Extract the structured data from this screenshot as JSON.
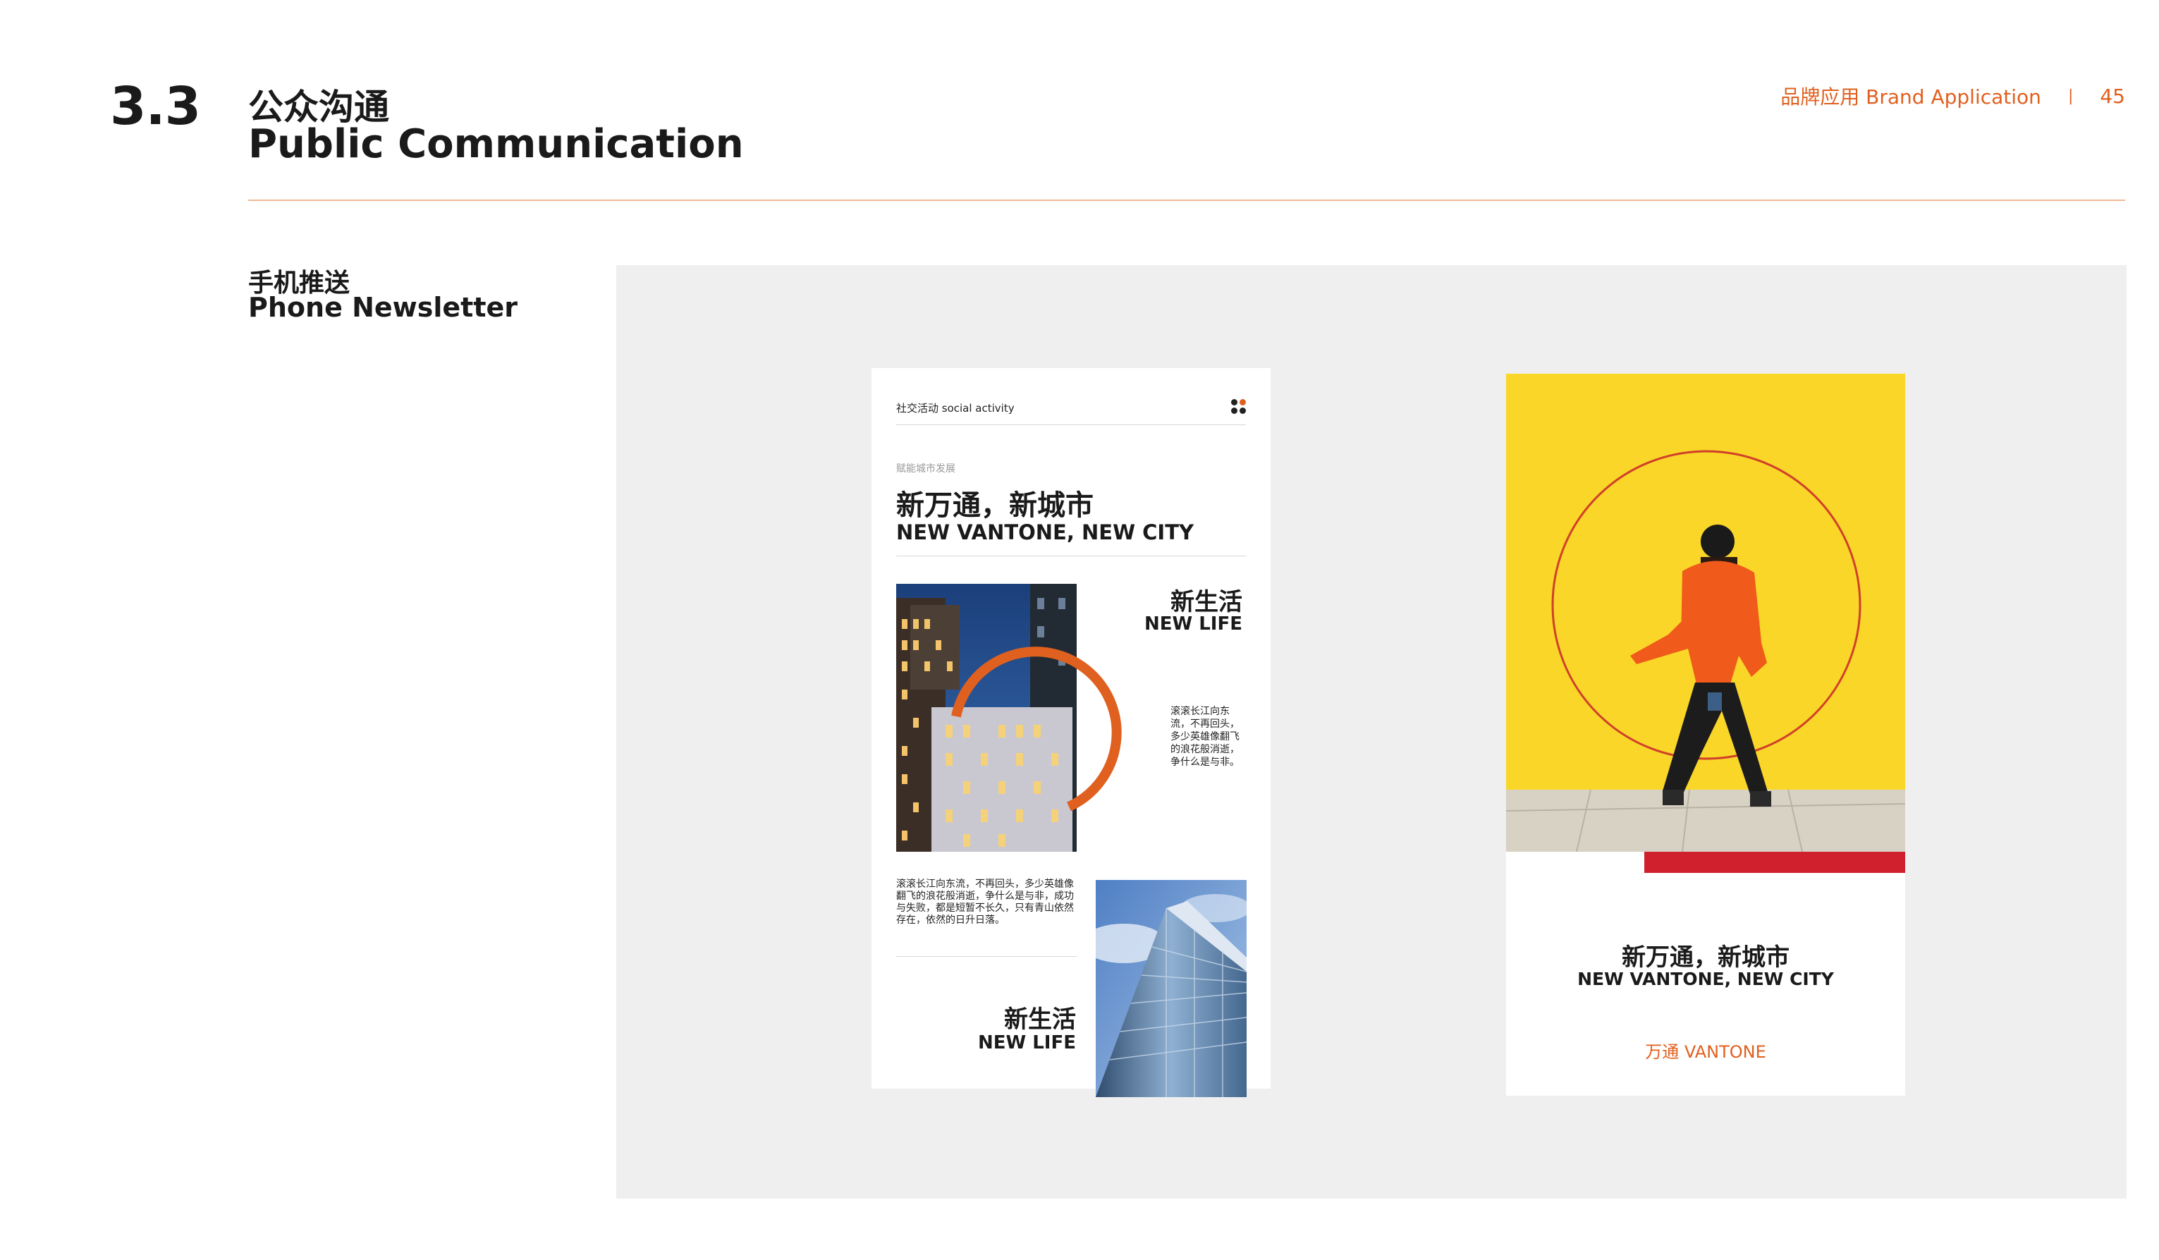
{
  "header": {
    "section_number": "3.3",
    "title_zh": "公众沟通",
    "title_en": "Public Communication",
    "category": "品牌应用 Brand Application",
    "separator": "|",
    "page_number": "45",
    "accent_color": "#e0601f"
  },
  "subsection": {
    "title_zh": "手机推送",
    "title_en": "Phone Newsletter"
  },
  "phone1": {
    "label": "社交活动 social activity",
    "small_caption": "赋能城市发展",
    "headline_zh": "新万通，新城市",
    "headline_en": "NEW VANTONE, NEW CITY",
    "new_life_zh": "新生活",
    "new_life_en": "NEW LIFE",
    "poem_short": "滚滚长江向东流，不再回头，多少英雄像翻飞的浪花般消逝，争什么是与非。",
    "paragraph": "滚滚长江向东流，不再回头，多少英雄像翻飞的浪花般消逝，争什么是与非，成功与失败，都是短暂不长久，只有青山依然存在，依然的日升日落。",
    "new_life2_zh": "新生活",
    "new_life2_en": "NEW LIFE"
  },
  "phone2": {
    "headline_zh": "新万通，新城市",
    "headline_en": "NEW VANTONE, NEW CITY",
    "logo_zh": "万通",
    "logo_en": "VANTONE"
  }
}
